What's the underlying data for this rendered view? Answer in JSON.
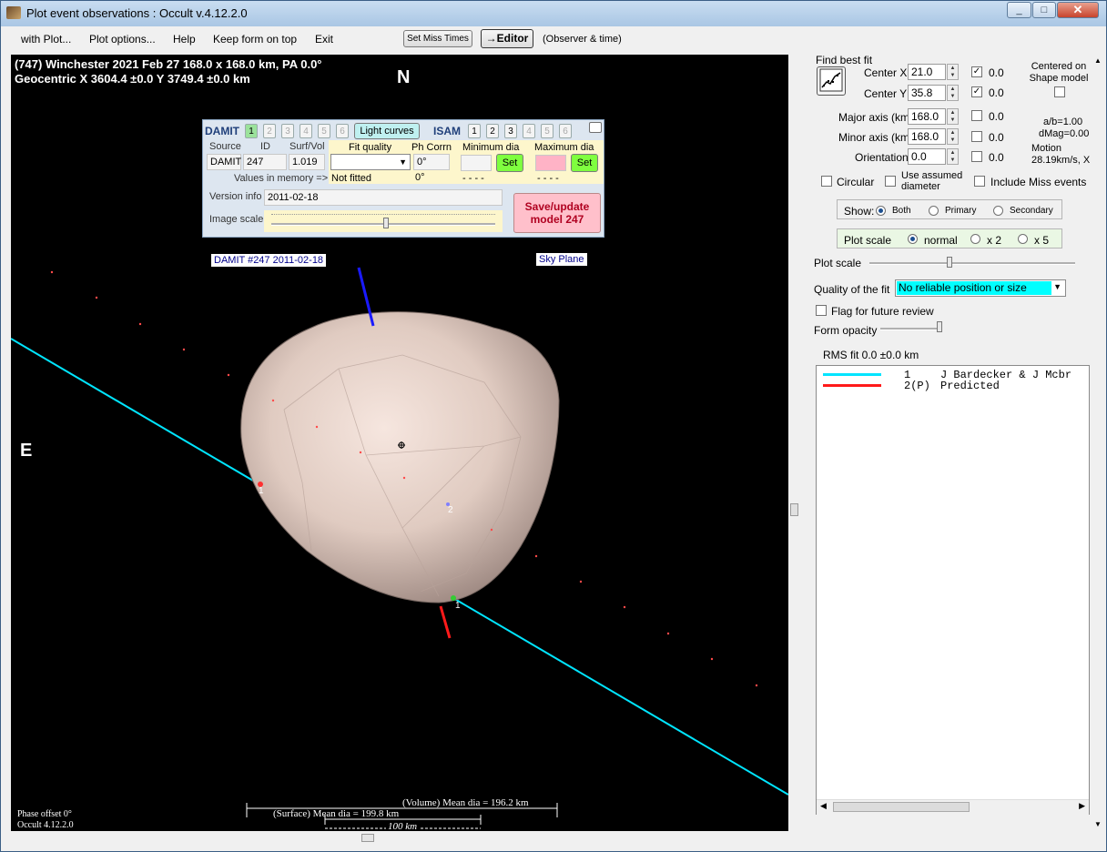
{
  "window": {
    "title": "Plot event observations : Occult v.4.12.2.0",
    "btn_min": "_",
    "btn_max": "□",
    "btn_close": "✕"
  },
  "menu": {
    "items": [
      "with Plot...",
      "Plot options...",
      "Help",
      "Keep form on top",
      "Exit"
    ],
    "set_miss_times": "Set Miss Times",
    "editor": "→Editor",
    "observer_time": "(Observer & time)"
  },
  "plot": {
    "header_line1": "(747) Winchester  2021 Feb 27  168.0 x 168.0 km, PA 0.0°",
    "header_line2": "Geocentric X 3604.4 ±0.0  Y 3749.4 ±0.0 km",
    "north": "N",
    "east": "E",
    "model_label": "DAMIT #247 2011-02-18",
    "sky_plane": "Sky Plane",
    "chord1": "1",
    "chord2": "2",
    "phase_offset": "Phase offset 0°",
    "version": "Occult 4.12.2.0",
    "volume_dia": "(Volume) Mean dia = 196.2 km",
    "surface_dia": "(Surface) Mean dia = 199.8 km",
    "scale_bar": "100 km"
  },
  "damit": {
    "damit_label": "DAMIT",
    "damit_numbers": [
      "1",
      "2",
      "3",
      "4",
      "5",
      "6"
    ],
    "light_curves": "Light curves",
    "isam_label": "ISAM",
    "isam_numbers": [
      "1",
      "2",
      "3",
      "4",
      "5",
      "6"
    ],
    "h_source": "Source",
    "h_id": "ID",
    "h_surfvol": "Surf/Vol",
    "h_fit": "Fit quality",
    "h_phcorr": "Ph Corrn",
    "h_min": "Minimum dia",
    "h_max": "Maximum dia",
    "source": "DAMIT",
    "id": "247",
    "surfvol": "1.019",
    "phcorr": "0°",
    "phcorr2": "0°",
    "not_fitted": "Not fitted",
    "values_mem": "Values in memory =>",
    "min_dash": "- - - -",
    "max_dash": "- - - -",
    "set": "Set",
    "version_label": "Version info",
    "version_val": "2011-02-18",
    "image_scale": "Image scale",
    "save_btn": "Save/update model 247"
  },
  "fit": {
    "find_best_fit": "Find best fit",
    "center_x_label": "Center X",
    "center_x": "21.0",
    "center_y_label": "Center Y",
    "center_y": "35.8",
    "major_label": "Major axis (km)",
    "major": "168.0",
    "minor_label": "Minor axis (km)",
    "minor": "168.0",
    "orient_label": "Orientation",
    "orient": "0.0",
    "zero": "0.0",
    "centered_on": "Centered on Shape model",
    "ab": "a/b=1.00",
    "dmag": "dMag=0.00",
    "motion": "Motion",
    "motion_val": "28.19km/s, X",
    "circular": "Circular",
    "assumed": "Use assumed diameter",
    "miss": "Include Miss events",
    "show": "Show:",
    "both": "Both",
    "primary": "Primary",
    "secondary": "Secondary",
    "plot_scale_grp": "Plot scale",
    "normal": "normal",
    "x2": "x 2",
    "x5": "x 5",
    "plot_scale": "Plot scale",
    "quality_label": "Quality of the fit",
    "quality": "No reliable position or size",
    "flag": "Flag for future review",
    "form_opacity": "Form opacity",
    "rms": "RMS fit 0.0 ±0.0 km"
  },
  "legend": [
    {
      "num": "1",
      "name": "J Bardecker & J Mcbr",
      "color": "#00e5ff"
    },
    {
      "num": "2(P)",
      "name": "Predicted",
      "color": "#ff1a1a"
    }
  ],
  "colors": {
    "chord_line": "#00e5ff",
    "predicted": "#ff1a1a",
    "north_vector": "#1a1aff",
    "quality_bg": "#00ffff"
  }
}
